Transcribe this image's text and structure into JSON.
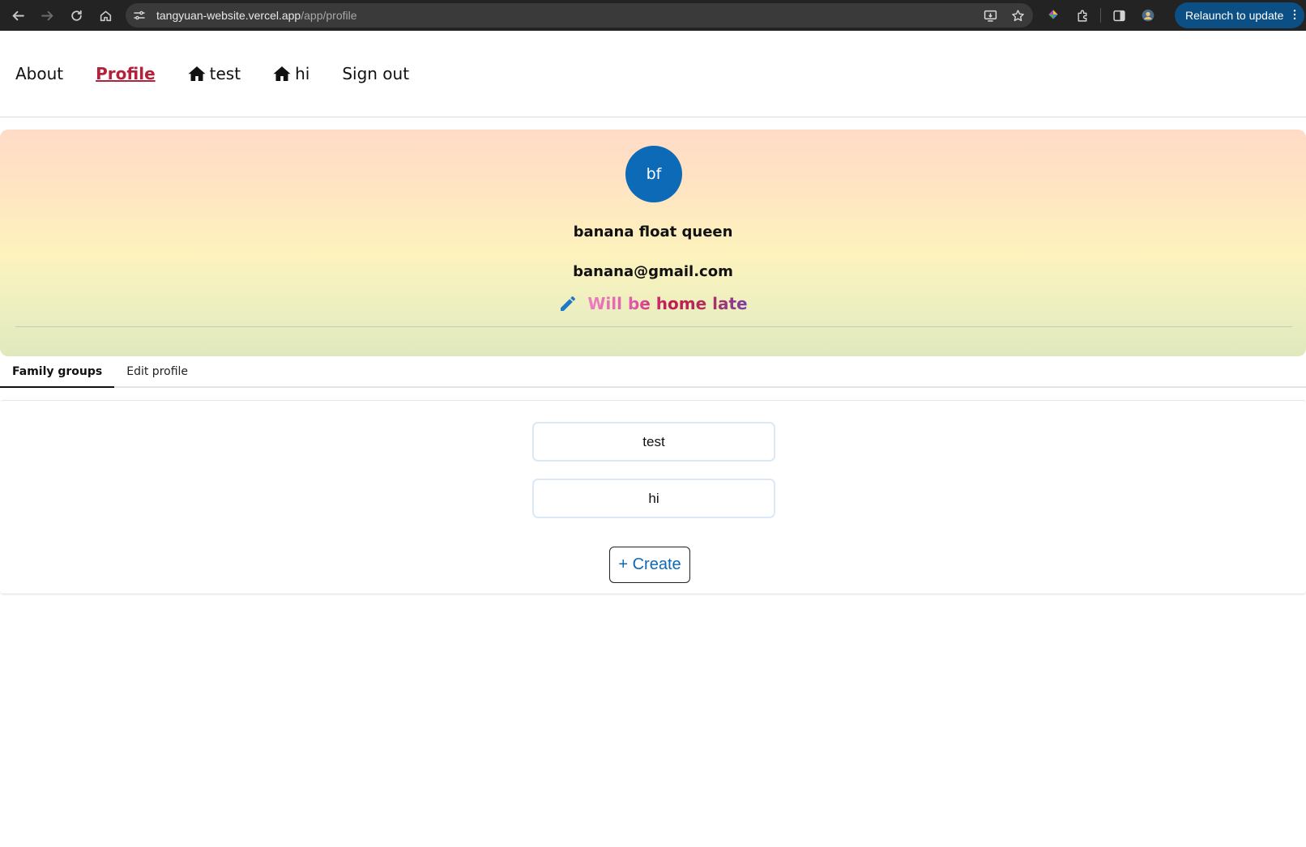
{
  "browser": {
    "url_host": "tangyuan-website.vercel.app",
    "url_path": "/app/profile",
    "relaunch_label": "Relaunch to update"
  },
  "nav": {
    "about": "About",
    "profile": "Profile",
    "group_test": "test",
    "group_hi": "hi",
    "sign_out": "Sign out"
  },
  "profile": {
    "avatar_initials": "bf",
    "avatar_color": "#0c6ab6",
    "name": "banana float queen",
    "email": "banana@gmail.com",
    "status": "Will be home late"
  },
  "tabs": [
    {
      "label": "Family groups",
      "active": true
    },
    {
      "label": "Edit profile",
      "active": false
    }
  ],
  "groups": [
    {
      "name": "test"
    },
    {
      "name": "hi"
    }
  ],
  "create_label": "+ Create",
  "colors": {
    "accent_active_nav": "#b3213b",
    "create_text": "#0d69b5",
    "relaunch_bg": "#0b4f84"
  }
}
